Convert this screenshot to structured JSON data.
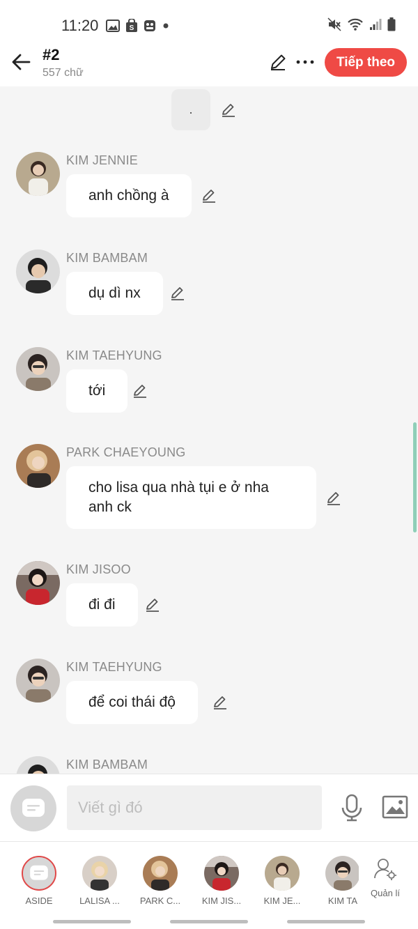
{
  "status_bar": {
    "time": "11:20",
    "left_icons": [
      "gallery-icon",
      "shopping-bag-icon",
      "app-icon",
      "notification-dot-icon"
    ],
    "right_icons": [
      "mute-icon",
      "wifi-icon",
      "signal-icon",
      "battery-icon"
    ]
  },
  "header": {
    "title": "#2",
    "subtitle": "557 chữ",
    "next_label": "Tiếp theo",
    "accent": "#ef4a45"
  },
  "chat": {
    "first_bubble": ".",
    "messages": [
      {
        "name": "KIM JENNIE",
        "text": "anh chồng à"
      },
      {
        "name": "KIM BAMBAM",
        "text": "dụ dì nx"
      },
      {
        "name": "KIM TAEHYUNG",
        "text": "tới"
      },
      {
        "name": "PARK CHAEYOUNG",
        "text": "cho lisa qua nhà tụi e ở nha anh ck"
      },
      {
        "name": "KIM JISOO",
        "text": "đi đi"
      },
      {
        "name": "KIM TAEHYUNG",
        "text": "để coi thái độ"
      },
      {
        "name": "KIM BAMBAM",
        "text": ""
      }
    ]
  },
  "composer": {
    "placeholder": "Viết gì đó",
    "value": ""
  },
  "characters": [
    {
      "label": "ASIDE"
    },
    {
      "label": "LALISA ..."
    },
    {
      "label": "PARK C..."
    },
    {
      "label": "KIM JIS..."
    },
    {
      "label": "KIM JE..."
    },
    {
      "label": "KIM TA"
    }
  ],
  "manage_label": "Quản lí"
}
